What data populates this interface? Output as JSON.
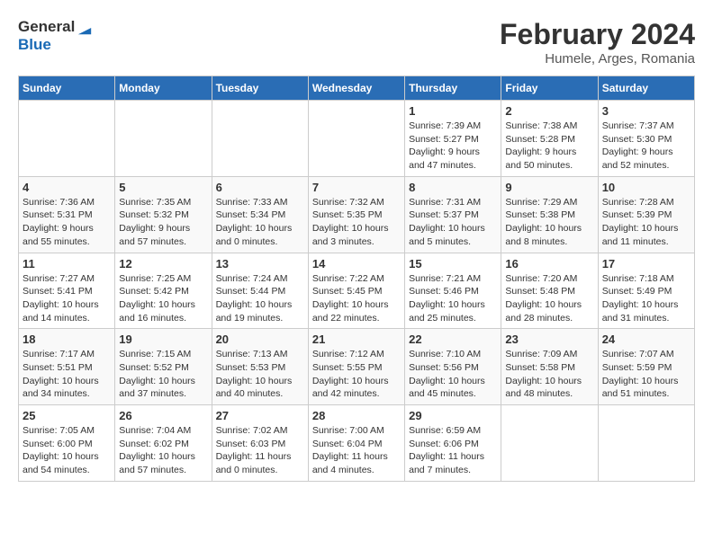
{
  "logo": {
    "line1": "General",
    "line2": "Blue"
  },
  "title": "February 2024",
  "subtitle": "Humele, Arges, Romania",
  "weekdays": [
    "Sunday",
    "Monday",
    "Tuesday",
    "Wednesday",
    "Thursday",
    "Friday",
    "Saturday"
  ],
  "weeks": [
    [
      {
        "day": "",
        "info": ""
      },
      {
        "day": "",
        "info": ""
      },
      {
        "day": "",
        "info": ""
      },
      {
        "day": "",
        "info": ""
      },
      {
        "day": "1",
        "info": "Sunrise: 7:39 AM\nSunset: 5:27 PM\nDaylight: 9 hours\nand 47 minutes."
      },
      {
        "day": "2",
        "info": "Sunrise: 7:38 AM\nSunset: 5:28 PM\nDaylight: 9 hours\nand 50 minutes."
      },
      {
        "day": "3",
        "info": "Sunrise: 7:37 AM\nSunset: 5:30 PM\nDaylight: 9 hours\nand 52 minutes."
      }
    ],
    [
      {
        "day": "4",
        "info": "Sunrise: 7:36 AM\nSunset: 5:31 PM\nDaylight: 9 hours\nand 55 minutes."
      },
      {
        "day": "5",
        "info": "Sunrise: 7:35 AM\nSunset: 5:32 PM\nDaylight: 9 hours\nand 57 minutes."
      },
      {
        "day": "6",
        "info": "Sunrise: 7:33 AM\nSunset: 5:34 PM\nDaylight: 10 hours\nand 0 minutes."
      },
      {
        "day": "7",
        "info": "Sunrise: 7:32 AM\nSunset: 5:35 PM\nDaylight: 10 hours\nand 3 minutes."
      },
      {
        "day": "8",
        "info": "Sunrise: 7:31 AM\nSunset: 5:37 PM\nDaylight: 10 hours\nand 5 minutes."
      },
      {
        "day": "9",
        "info": "Sunrise: 7:29 AM\nSunset: 5:38 PM\nDaylight: 10 hours\nand 8 minutes."
      },
      {
        "day": "10",
        "info": "Sunrise: 7:28 AM\nSunset: 5:39 PM\nDaylight: 10 hours\nand 11 minutes."
      }
    ],
    [
      {
        "day": "11",
        "info": "Sunrise: 7:27 AM\nSunset: 5:41 PM\nDaylight: 10 hours\nand 14 minutes."
      },
      {
        "day": "12",
        "info": "Sunrise: 7:25 AM\nSunset: 5:42 PM\nDaylight: 10 hours\nand 16 minutes."
      },
      {
        "day": "13",
        "info": "Sunrise: 7:24 AM\nSunset: 5:44 PM\nDaylight: 10 hours\nand 19 minutes."
      },
      {
        "day": "14",
        "info": "Sunrise: 7:22 AM\nSunset: 5:45 PM\nDaylight: 10 hours\nand 22 minutes."
      },
      {
        "day": "15",
        "info": "Sunrise: 7:21 AM\nSunset: 5:46 PM\nDaylight: 10 hours\nand 25 minutes."
      },
      {
        "day": "16",
        "info": "Sunrise: 7:20 AM\nSunset: 5:48 PM\nDaylight: 10 hours\nand 28 minutes."
      },
      {
        "day": "17",
        "info": "Sunrise: 7:18 AM\nSunset: 5:49 PM\nDaylight: 10 hours\nand 31 minutes."
      }
    ],
    [
      {
        "day": "18",
        "info": "Sunrise: 7:17 AM\nSunset: 5:51 PM\nDaylight: 10 hours\nand 34 minutes."
      },
      {
        "day": "19",
        "info": "Sunrise: 7:15 AM\nSunset: 5:52 PM\nDaylight: 10 hours\nand 37 minutes."
      },
      {
        "day": "20",
        "info": "Sunrise: 7:13 AM\nSunset: 5:53 PM\nDaylight: 10 hours\nand 40 minutes."
      },
      {
        "day": "21",
        "info": "Sunrise: 7:12 AM\nSunset: 5:55 PM\nDaylight: 10 hours\nand 42 minutes."
      },
      {
        "day": "22",
        "info": "Sunrise: 7:10 AM\nSunset: 5:56 PM\nDaylight: 10 hours\nand 45 minutes."
      },
      {
        "day": "23",
        "info": "Sunrise: 7:09 AM\nSunset: 5:58 PM\nDaylight: 10 hours\nand 48 minutes."
      },
      {
        "day": "24",
        "info": "Sunrise: 7:07 AM\nSunset: 5:59 PM\nDaylight: 10 hours\nand 51 minutes."
      }
    ],
    [
      {
        "day": "25",
        "info": "Sunrise: 7:05 AM\nSunset: 6:00 PM\nDaylight: 10 hours\nand 54 minutes."
      },
      {
        "day": "26",
        "info": "Sunrise: 7:04 AM\nSunset: 6:02 PM\nDaylight: 10 hours\nand 57 minutes."
      },
      {
        "day": "27",
        "info": "Sunrise: 7:02 AM\nSunset: 6:03 PM\nDaylight: 11 hours\nand 0 minutes."
      },
      {
        "day": "28",
        "info": "Sunrise: 7:00 AM\nSunset: 6:04 PM\nDaylight: 11 hours\nand 4 minutes."
      },
      {
        "day": "29",
        "info": "Sunrise: 6:59 AM\nSunset: 6:06 PM\nDaylight: 11 hours\nand 7 minutes."
      },
      {
        "day": "",
        "info": ""
      },
      {
        "day": "",
        "info": ""
      }
    ]
  ]
}
